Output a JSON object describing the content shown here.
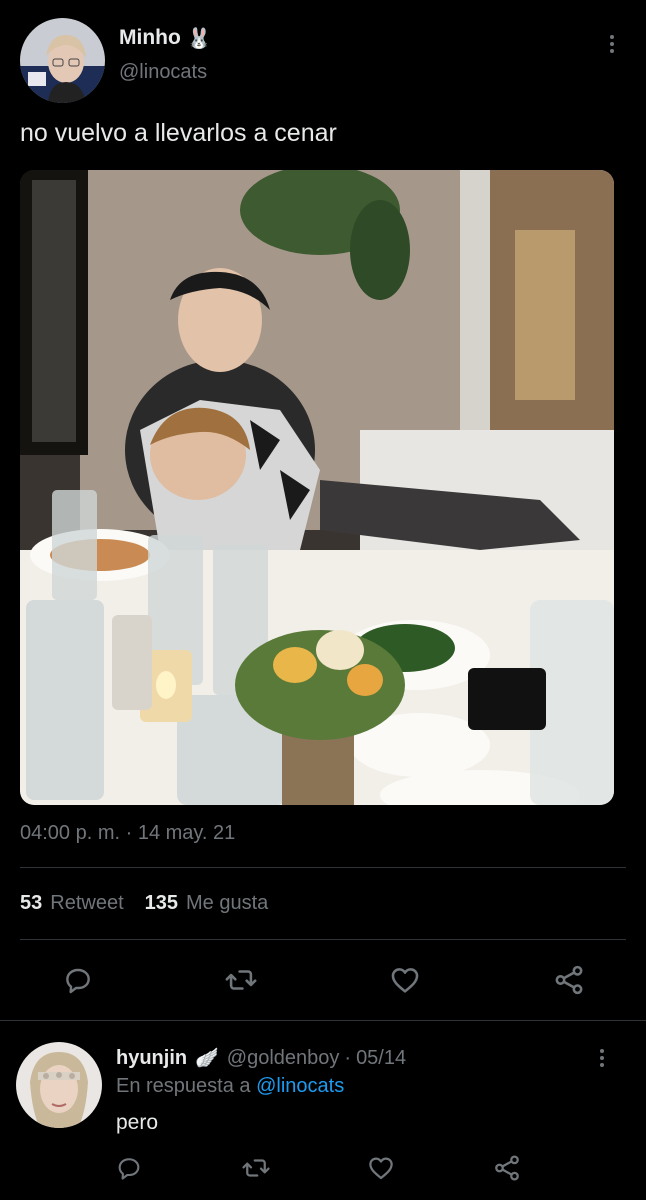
{
  "tweet": {
    "author_name": "Minho",
    "author_emoji": "🐰",
    "author_handle": "@linocats",
    "text": "no vuelvo a llevarlos a cenar",
    "timestamp": "04:00 p. m. · 14 may. 21",
    "retweet_count": "53",
    "retweet_label": "Retweet",
    "like_count": "135",
    "like_label": "Me gusta"
  },
  "actions": {
    "reply_icon": "reply-icon",
    "retweet_icon": "retweet-icon",
    "like_icon": "heart-icon",
    "share_icon": "share-icon"
  },
  "reply": {
    "author_name": "hyunjin",
    "author_emoji": "🪽",
    "author_handle": "@goldenboy",
    "date": "05/14",
    "in_reply_prefix": "En respuesta a",
    "in_reply_handle": "@linocats",
    "text": "pero"
  },
  "colors": {
    "background": "#000000",
    "text": "#e7e9ea",
    "muted": "#71767b",
    "link": "#1d9bf0",
    "divider": "#2f3336"
  }
}
